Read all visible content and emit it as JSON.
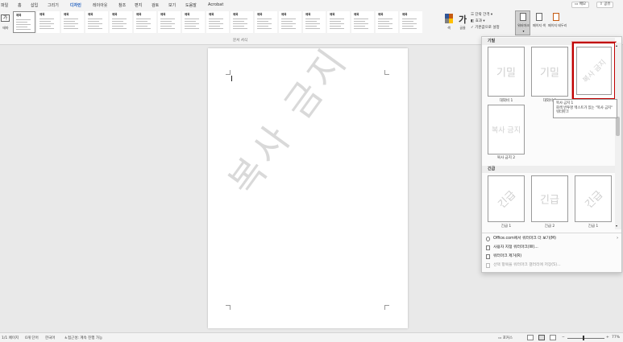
{
  "tabs": [
    "파일",
    "홈",
    "삽입",
    "그리기",
    "디자인",
    "레이아웃",
    "참조",
    "편지",
    "검토",
    "보기",
    "도움말",
    "Acrobat"
  ],
  "active_tab": "디자인",
  "top_right": {
    "memo_label": "메모",
    "share_label": "공유"
  },
  "ribbon": {
    "theme_label": "테마",
    "theme_icon_text": "가",
    "styles_group_label": "문서 서식",
    "thumb_titles": [
      "제목",
      "제목",
      "제목",
      "제목",
      "제목",
      "제목",
      "제목",
      "제목",
      "제목",
      "제목",
      "제목",
      "제목",
      "제목",
      "제목",
      "제목",
      "제목",
      "제목"
    ],
    "colors_label": "색",
    "fonts_label": "글꼴",
    "fonts_icon_text": "가",
    "paragraph_spacing_label": "단락 간격",
    "effects_label": "효과",
    "set_default_label": "기본값으로 설정",
    "watermark_label": "워터마크",
    "page_color_label": "페이지 색",
    "page_borders_label": "페이지 테두리"
  },
  "document": {
    "watermark_text": "복사 금지"
  },
  "watermark_panel": {
    "section_confidential": "기밀",
    "section_urgent": "긴급",
    "items_confidential": [
      {
        "text": "기밀",
        "caption": "대외비 1"
      },
      {
        "text": "기밀",
        "caption": "대외비 2"
      },
      {
        "text": "복사 금지",
        "caption": "복사 금지 1"
      },
      {
        "text": "복사 금지",
        "caption": "복사 금지 2"
      }
    ],
    "items_urgent": [
      {
        "text": "긴급",
        "caption": "긴급 1"
      },
      {
        "text": "긴급",
        "caption": "긴급 2"
      },
      {
        "text": "긴급",
        "caption": "긴급 1"
      }
    ],
    "menu": [
      "Office.com에서 워터마크 더 보기(M)",
      "사용자 지정 워터마크(W)...",
      "워터마크 제거(R)",
      "선택 항목을 워터마크 갤러리에 저장(S)..."
    ],
    "tooltip": {
      "title": "복사 금지 1",
      "body": "회색 반투명 텍스트가 있는 \"복사 금지\" 워터마크"
    }
  },
  "status_bar": {
    "page": "1/1 페이지",
    "words": "0개 단어",
    "language": "한국어",
    "accessibility": "접근성: 계속 진행 가능",
    "focus": "포커스",
    "zoom": "77%"
  }
}
